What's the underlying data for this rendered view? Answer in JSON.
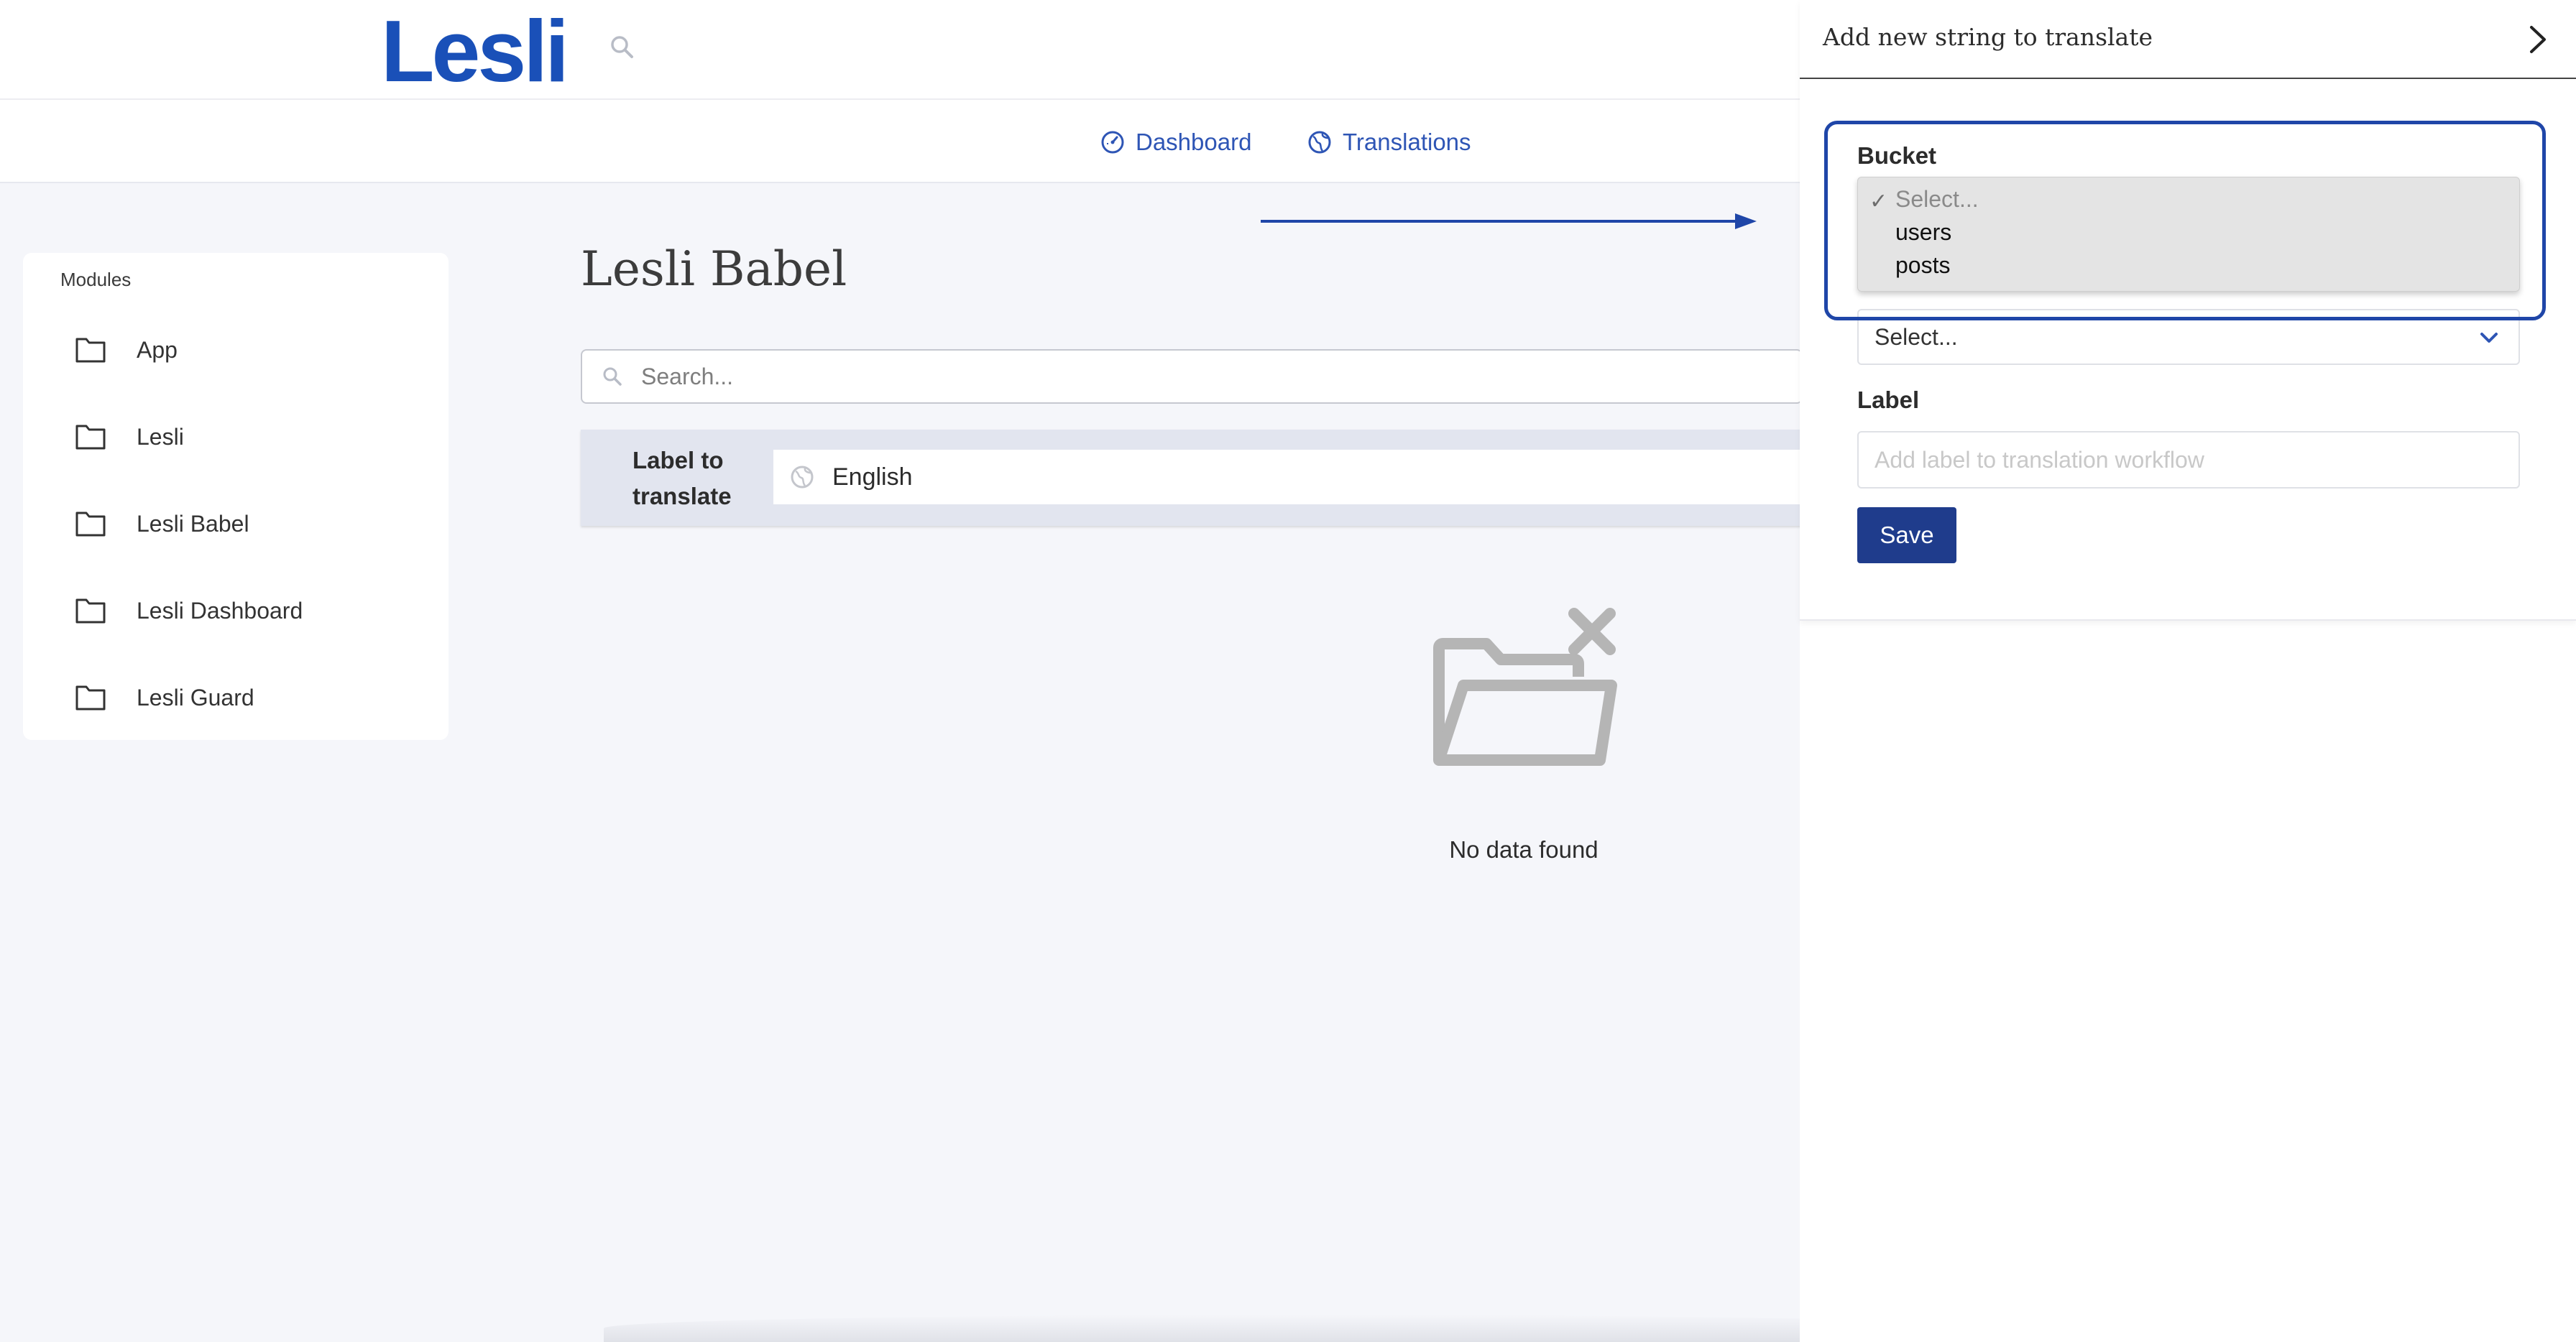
{
  "app": {
    "logo_text": "Lesli"
  },
  "nav": {
    "dashboard": {
      "label": "Dashboard",
      "icon": "dashboard-gauge-icon"
    },
    "translations": {
      "label": "Translations",
      "icon": "globe-icon"
    }
  },
  "sidebar": {
    "heading": "Modules",
    "items": [
      {
        "label": "App",
        "icon": "folder-icon"
      },
      {
        "label": "Lesli",
        "icon": "folder-icon"
      },
      {
        "label": "Lesli Babel",
        "icon": "folder-icon"
      },
      {
        "label": "Lesli Dashboard",
        "icon": "folder-icon"
      },
      {
        "label": "Lesli Guard",
        "icon": "folder-icon"
      }
    ]
  },
  "main": {
    "title": "Lesli Babel",
    "search": {
      "placeholder": "Search..."
    },
    "table": {
      "label_header": "Label to translate",
      "language": "English"
    },
    "empty": {
      "text": "No data found",
      "icon": "folder-empty-icon"
    }
  },
  "panel": {
    "title": "Add new string to translate",
    "bucket": {
      "label": "Bucket",
      "options": [
        "Select...",
        "users",
        "posts"
      ],
      "selected": "Select..."
    },
    "second_select": {
      "value": "Select..."
    },
    "label_field": {
      "label": "Label",
      "placeholder": "Add label to translation workflow",
      "value": ""
    },
    "save_label": "Save"
  },
  "colors": {
    "brand": "#1a50b8",
    "nav_link": "#2e55b5",
    "save_button": "#1f3c8c",
    "highlight_border": "#1f46a8",
    "page_bg": "#f5f6fa",
    "table_header_bg": "#e2e5ef"
  }
}
